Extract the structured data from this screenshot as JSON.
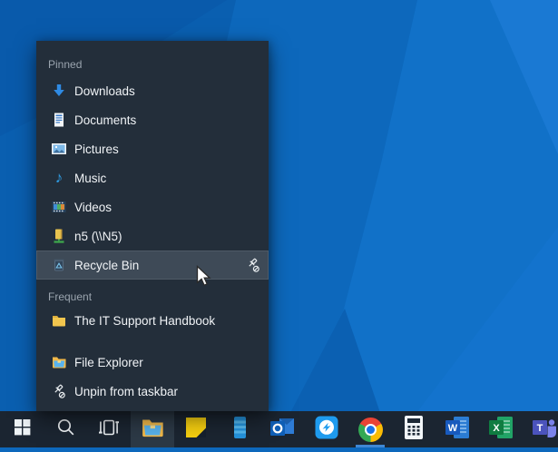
{
  "desktop": {
    "colors": {
      "wallpaper_base": "#0d68bc",
      "wallpaper_dark_facet": "#0a5fb0",
      "wallpaper_light_facet": "#1171c8",
      "wallpaper_lightest_facet": "#1a79d3"
    }
  },
  "jumplist": {
    "colors": {
      "panel_bg": "#232e3a",
      "highlight_bg": "#3e4a57",
      "header_text": "#9aa4ae",
      "item_text": "#f0f3f6"
    },
    "sections": [
      {
        "header": "Pinned",
        "items": [
          {
            "label": "Downloads",
            "icon": "downloads-icon"
          },
          {
            "label": "Documents",
            "icon": "documents-icon"
          },
          {
            "label": "Pictures",
            "icon": "pictures-icon"
          },
          {
            "label": "Music",
            "icon": "music-icon",
            "glyph": "♪"
          },
          {
            "label": "Videos",
            "icon": "videos-icon"
          },
          {
            "label": "n5 (\\\\N5)",
            "icon": "network-drive-icon"
          },
          {
            "label": "Recycle Bin",
            "icon": "recycle-bin-icon",
            "highlighted": true,
            "trailing_icon": "unpin-from-list-icon"
          }
        ]
      },
      {
        "header": "Frequent",
        "items": [
          {
            "label": "The IT Support Handbook",
            "icon": "folder-icon"
          }
        ]
      }
    ],
    "tasks": [
      {
        "label": "File Explorer",
        "icon": "file-explorer-icon"
      },
      {
        "label": "Unpin from taskbar",
        "icon": "unpin-icon"
      }
    ]
  },
  "taskbar": {
    "colors": {
      "bar_bg": "#1b2531",
      "active_button_bg": "#2c3946",
      "running_underline": "#3f87d4"
    },
    "buttons": [
      {
        "name": "start",
        "icon": "windows-logo-icon"
      },
      {
        "name": "search",
        "icon": "search-icon"
      },
      {
        "name": "task-view",
        "icon": "task-view-icon"
      },
      {
        "name": "file-explorer",
        "icon": "file-explorer-icon",
        "active": true
      },
      {
        "name": "sticky-notes",
        "icon": "sticky-notes-icon"
      },
      {
        "name": "your-phone",
        "icon": "your-phone-icon"
      },
      {
        "name": "outlook",
        "icon": "outlook-icon"
      },
      {
        "name": "messenger",
        "icon": "messenger-icon"
      },
      {
        "name": "chrome",
        "icon": "chrome-icon",
        "running": true
      },
      {
        "name": "calculator",
        "icon": "calculator-icon"
      },
      {
        "name": "word",
        "icon": "word-icon",
        "letter": "W"
      },
      {
        "name": "excel",
        "icon": "excel-icon",
        "letter": "X"
      },
      {
        "name": "teams",
        "icon": "teams-icon",
        "letter": "T"
      }
    ]
  }
}
